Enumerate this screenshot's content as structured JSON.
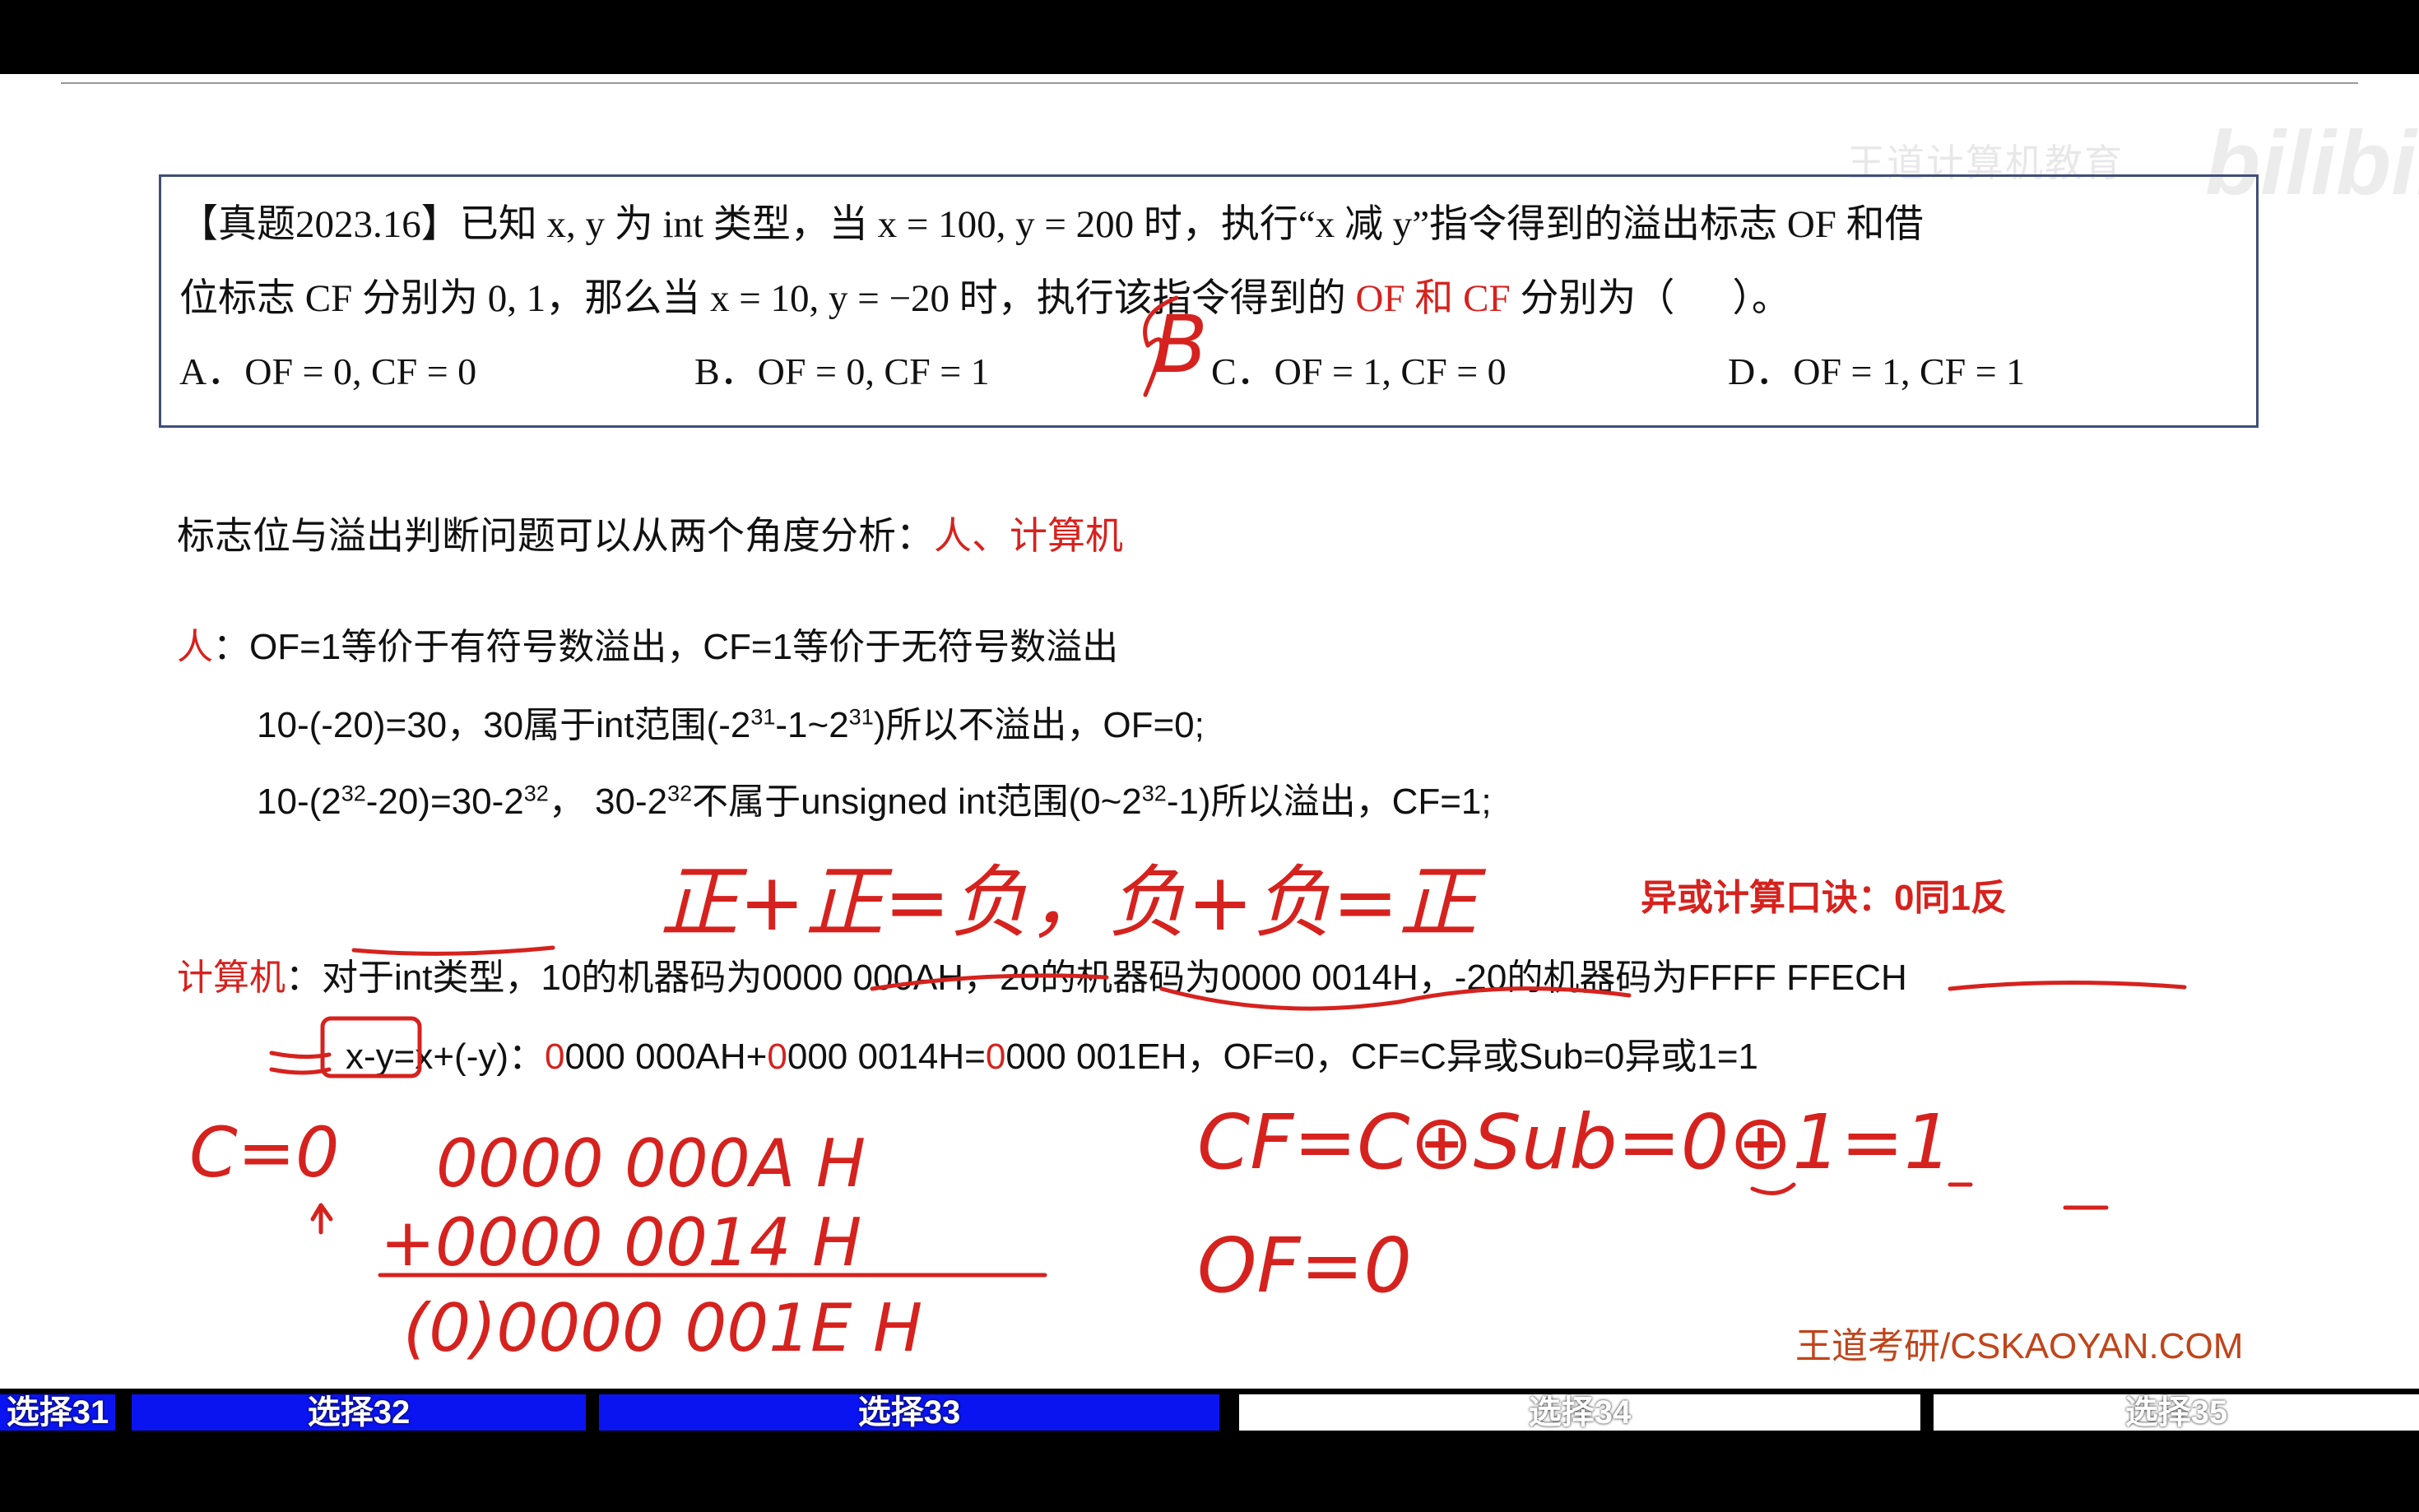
{
  "question": {
    "tag": "【真题2023.16】",
    "line1_a": "已知 x, y 为 int 类型，当 x = 100, y = 200 时，执行“x 减 y”指令得到的溢出标志 OF 和借",
    "line2_a": "位标志 CF 分别为 0, 1，那么当 x = 10, y = −20 时，执行该指令得到的",
    "line2_red": "OF 和 CF",
    "line2_b": "分别为（",
    "line2_c": "）。",
    "options": [
      {
        "text": "A．OF = 0, CF = 0"
      },
      {
        "text": "B．OF = 0, CF = 1"
      },
      {
        "text": "C．OF = 1, CF = 0"
      },
      {
        "text": "D．OF = 1, CF = 1"
      }
    ]
  },
  "analysis": {
    "intro": "标志位与溢出判断问题可以从两个角度分析：",
    "intro_red": "人、计算机",
    "person_label": "人",
    "person_text": "：OF=1等价于有符号数溢出，CF=1等价于无符号数溢出",
    "p1_a": "10-(-20)=30，30属于int范围(-2",
    "p1_sup1": "31",
    "p1_b": "-1~2",
    "p1_sup2": "31",
    "p1_c": ")所以不溢出，OF=0;",
    "p2_a": "10-(2",
    "p2_sup1": "32",
    "p2_b": "-20)=30-2",
    "p2_sup2": "32",
    "p2_c": "， 30-2",
    "p2_sup3": "32",
    "p2_d": "不属于unsigned int范围(0~2",
    "p2_sup4": "32",
    "p2_e": "-1)所以溢出，CF=1;",
    "mnemonic": "异或计算口诀：0同1反",
    "computer_label": "计算机",
    "computer_text": "：对于int类型，10的机器码为0000 000AH，20的机器码为0000 0014H，-20的机器码为FFFF FFECH",
    "c1_a": "x-y=x+(-y)：",
    "c1_r1": "0",
    "c1_b": "000 000AH+",
    "c1_r2": "0",
    "c1_c": "000 0014H=",
    "c1_r3": "0",
    "c1_d": "000 001EH，OF=0，CF=C异或Sub=0异或1=1"
  },
  "handwriting": {
    "answer": "B",
    "rule": "正+正=负，负+负=正",
    "carry": "C=0",
    "sum1": "0000 000A H",
    "sum2": "+0000 0014 H",
    "sum3": "(0)0000 001E H",
    "cf": "CF=C⊕Sub=0⊕1=1",
    "of": "OF=0"
  },
  "brand": "王道考研/CSKAOYAN.COM",
  "chapters": [
    {
      "label": "选择31",
      "active": true
    },
    {
      "label": "选择32",
      "active": true
    },
    {
      "label": "选择33",
      "active": true
    },
    {
      "label": "选择34",
      "active": false
    },
    {
      "label": "选择35",
      "active": false
    }
  ],
  "colors": {
    "accent_red": "#d6221e",
    "chapter_blue": "#0a14f0",
    "box_border": "#3f4f7a"
  }
}
